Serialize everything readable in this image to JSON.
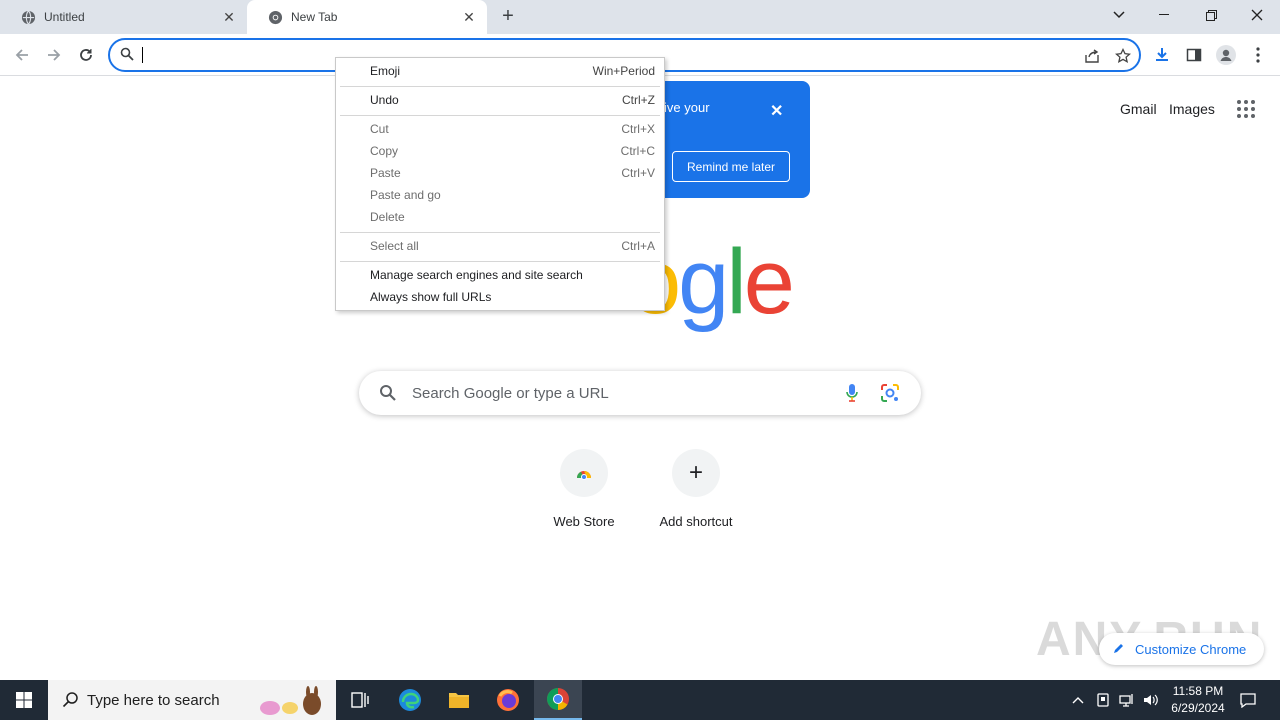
{
  "tabs": [
    {
      "title": "Untitled"
    },
    {
      "title": "New Tab"
    }
  ],
  "toplinks": {
    "gmail": "Gmail",
    "images": "Images"
  },
  "promo": {
    "text": "ive your",
    "button": "Remind me later"
  },
  "logo_visible": "ogle",
  "search": {
    "placeholder": "Search Google or type a URL"
  },
  "shortcuts": [
    {
      "label": "Web Store"
    },
    {
      "label": "Add shortcut"
    }
  ],
  "customize": {
    "label": "Customize Chrome"
  },
  "watermark": "ANY.RUN",
  "context_menu": {
    "items": [
      {
        "label": "Emoji",
        "shortcut": "Win+Period"
      },
      {
        "label": "Undo",
        "shortcut": "Ctrl+Z"
      },
      {
        "label": "Cut",
        "shortcut": "Ctrl+X"
      },
      {
        "label": "Copy",
        "shortcut": "Ctrl+C"
      },
      {
        "label": "Paste",
        "shortcut": "Ctrl+V"
      },
      {
        "label": "Paste and go",
        "shortcut": ""
      },
      {
        "label": "Delete",
        "shortcut": ""
      },
      {
        "label": "Select all",
        "shortcut": "Ctrl+A"
      },
      {
        "label": "Manage search engines and site search",
        "shortcut": ""
      },
      {
        "label": "Always show full URLs",
        "shortcut": ""
      }
    ]
  },
  "taskbar": {
    "search_placeholder": "Type here to search",
    "time": "11:58 PM",
    "date": "6/29/2024"
  },
  "colors": {
    "accent": "#1a73e8",
    "taskbar": "#202a36"
  }
}
